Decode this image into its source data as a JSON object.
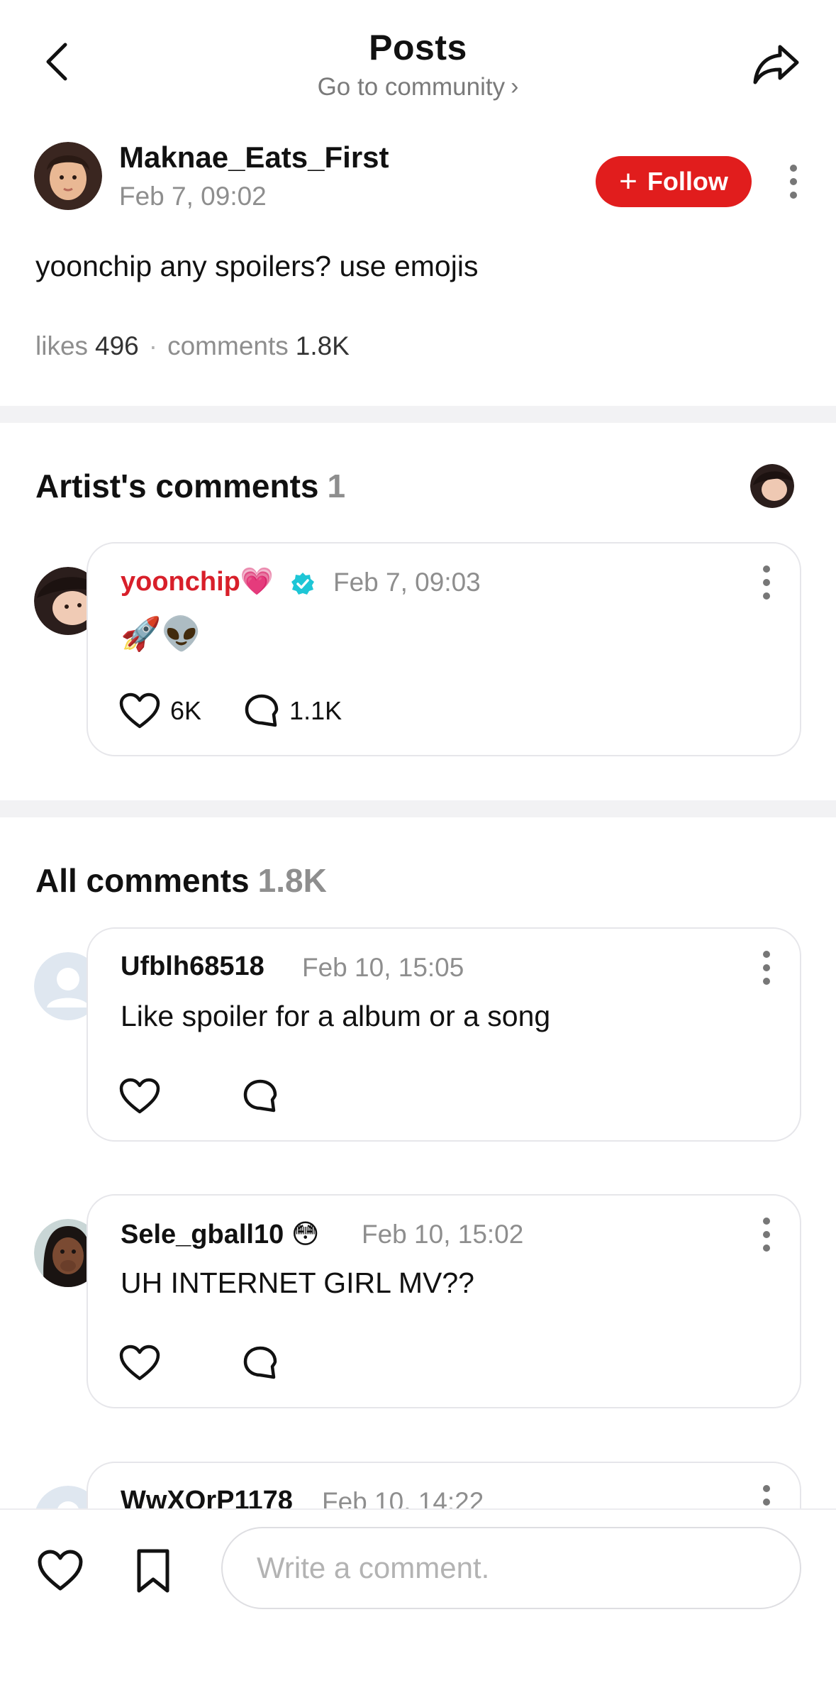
{
  "header": {
    "title": "Posts",
    "subtitle": "Go to community",
    "subtitle_chevron": "›"
  },
  "post": {
    "author": "Maknae_Eats_First",
    "date": "Feb 7, 09:02",
    "follow_label": "Follow",
    "body": "yoonchip any spoilers? use emojis",
    "likes_label": "likes",
    "likes_value": "496",
    "comments_label": "comments",
    "comments_value": "1.8K"
  },
  "artist_section": {
    "title": "Artist's comments",
    "count": "1",
    "comment": {
      "name": "yoonchip",
      "badge_emoji": "💗",
      "date": "Feb 7, 09:03",
      "text": "🚀👽",
      "likes": "6K",
      "replies": "1.1K"
    }
  },
  "all_section": {
    "title": "All comments",
    "count": "1.8K",
    "comments": [
      {
        "name": "Ufblh68518",
        "date": "Feb 10, 15:05",
        "text": "Like spoiler for a album or a song"
      },
      {
        "name": "Sele_gball10",
        "name_emoji": "😳",
        "date": "Feb 10, 15:02",
        "text": "UH INTERNET GIRL MV??"
      },
      {
        "name": "WwXOrP1178",
        "date": "Feb 10, 14:22",
        "text": ""
      }
    ]
  },
  "bottom_bar": {
    "input_placeholder": "Write a comment."
  },
  "colors": {
    "accent_red": "#e11d1d",
    "artist_name": "#d81f2a",
    "verified": "#1ec6d6",
    "muted_text": "#8e8e8e"
  },
  "icons": [
    "back-arrow-icon",
    "share-icon",
    "more-vert-icon",
    "heart-icon",
    "comment-bubble-icon",
    "bookmark-icon",
    "verified-badge-icon",
    "default-avatar-icon"
  ]
}
